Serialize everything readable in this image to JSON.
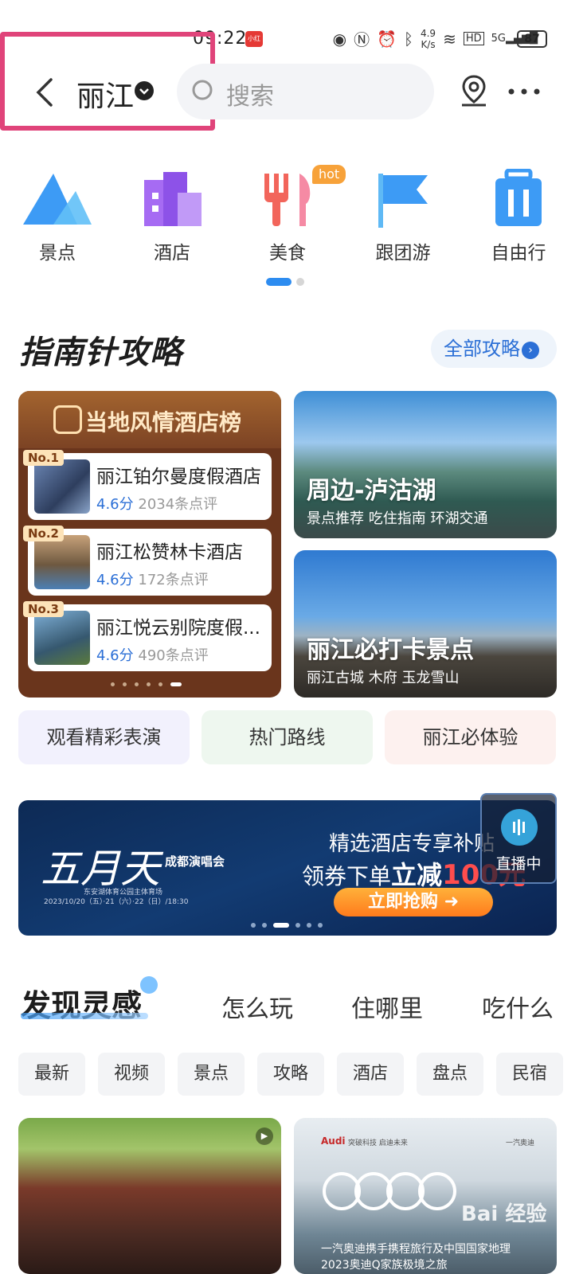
{
  "status_bar": {
    "time": "09:22",
    "app_badge": "小红书",
    "net_speed": "4.9\nK/s",
    "battery": "87",
    "signal": "5G",
    "hd": "HD"
  },
  "header": {
    "city": "丽江",
    "search_placeholder": "搜索"
  },
  "categories": [
    {
      "label": "景点"
    },
    {
      "label": "酒店"
    },
    {
      "label": "美食",
      "badge": "hot"
    },
    {
      "label": "跟团游"
    },
    {
      "label": "自由行"
    }
  ],
  "guide": {
    "title": "指南针攻略",
    "all_label": "全部攻略",
    "rank_title": "当地风情酒店榜",
    "hotels": [
      {
        "rank": "No.1",
        "name": "丽江铂尔曼度假酒店",
        "score": "4.6分",
        "reviews": "2034条点评"
      },
      {
        "rank": "No.2",
        "name": "丽江松赞林卡酒店",
        "score": "4.6分",
        "reviews": "172条点评"
      },
      {
        "rank": "No.3",
        "name": "丽江悦云别院度假...",
        "score": "4.6分",
        "reviews": "490条点评"
      }
    ],
    "cards": [
      {
        "title": "周边-泸沽湖",
        "subtitle": "景点推荐 吃住指南 环湖交通"
      },
      {
        "title": "丽江必打卡景点",
        "subtitle": "丽江古城 木府 玉龙雪山"
      }
    ]
  },
  "pills": [
    "观看精彩表演",
    "热门路线",
    "丽江必体验"
  ],
  "banner": {
    "brand": "五月天",
    "concert": "成都演唱会",
    "venue": "东安湖体育公园主体育场",
    "dates": "2023/10/20（五）·21（六）·22（日）/18:30",
    "line1": "精选酒店专享补贴",
    "line2_a": "领券下单",
    "line2_b": "立减",
    "line2_c": "100元",
    "cta": "立即抢购",
    "live_label": "直播中"
  },
  "discover": {
    "title": "发现灵感",
    "tabs": [
      "怎么玩",
      "住哪里",
      "吃什么"
    ],
    "chips": [
      "最新",
      "视频",
      "景点",
      "攻略",
      "酒店",
      "盘点",
      "民宿"
    ],
    "ad_brand": "Audi",
    "ad_tag": "突破科技 启迪未来",
    "ad_tag2": "一汽奥迪",
    "ad_line1": "一汽奥迪携手携程旅行及中国国家地理",
    "ad_line2": "2023奥迪Q家族极境之旅",
    "watermark": "Bai 经验"
  },
  "colors": {
    "accent": "#2d8cf0",
    "highlight_box": "#e0447a",
    "rank_bg": "#6a351c"
  }
}
